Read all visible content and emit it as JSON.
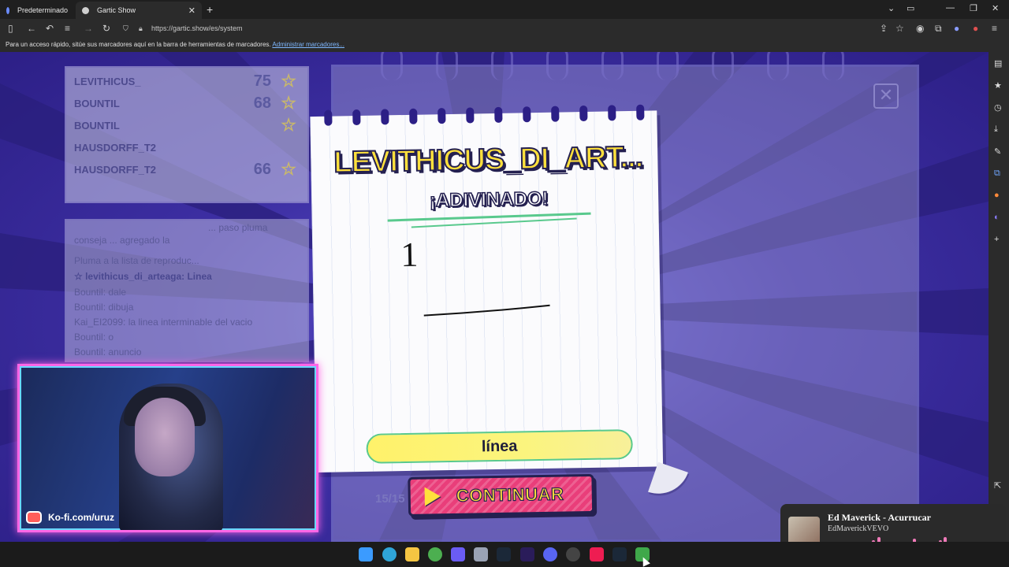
{
  "browser": {
    "tabs": [
      {
        "label": "Predeterminado",
        "active": false
      },
      {
        "label": "Gartic Show",
        "active": true
      }
    ],
    "url": "https://gartic.show/es/system",
    "bookmarks_msg": "Para un acceso rápido, sitúe sus marcadores aquí en la barra de herramientas de marcadores.",
    "bookmarks_link": "Administrar marcadores..."
  },
  "ranking": [
    {
      "name": "LEVITHICUS_",
      "points": "75"
    },
    {
      "name": "BOUNTIL",
      "points": "68"
    },
    {
      "name": "BOUNTIL",
      "points": ""
    },
    {
      "name": "HAUSDORFF_T2",
      "points": ""
    },
    {
      "name": "HAUSDORFF_T2",
      "points": "66"
    }
  ],
  "chat": [
    {
      "text": "... paso pluma"
    },
    {
      "text": "conseja ... agregado la"
    },
    {
      "text": "Pluma a la lista de reproduc..."
    },
    {
      "text": "☆ levithicus_di_arteaga: Linea"
    },
    {
      "text": "Bountil: dale"
    },
    {
      "text": "Bountil: dibuja"
    },
    {
      "text": "Kai_EI2099: la linea interminable del vacio"
    },
    {
      "text": "Bountil: o"
    },
    {
      "text": "Bountil: anuncio"
    }
  ],
  "card": {
    "winner": "LEVITHICUS_DI_ART...",
    "status": "¡ADIVINADO!",
    "drawing_digit": "1",
    "answer": "línea",
    "continue_label": "CONTINUAR"
  },
  "board": {
    "round": "15/15"
  },
  "stream": {
    "kofi": "Ko-fi.com/uruz"
  },
  "now_playing": {
    "title": "Ed Maverick - Acurrucar",
    "artist": "EdMaverickVEVO"
  },
  "colors": {
    "accent_yellow": "#ffe03c",
    "accent_pink": "#e93e7a",
    "accent_green": "#59c98d",
    "background_purple": "#3d2fa3"
  }
}
